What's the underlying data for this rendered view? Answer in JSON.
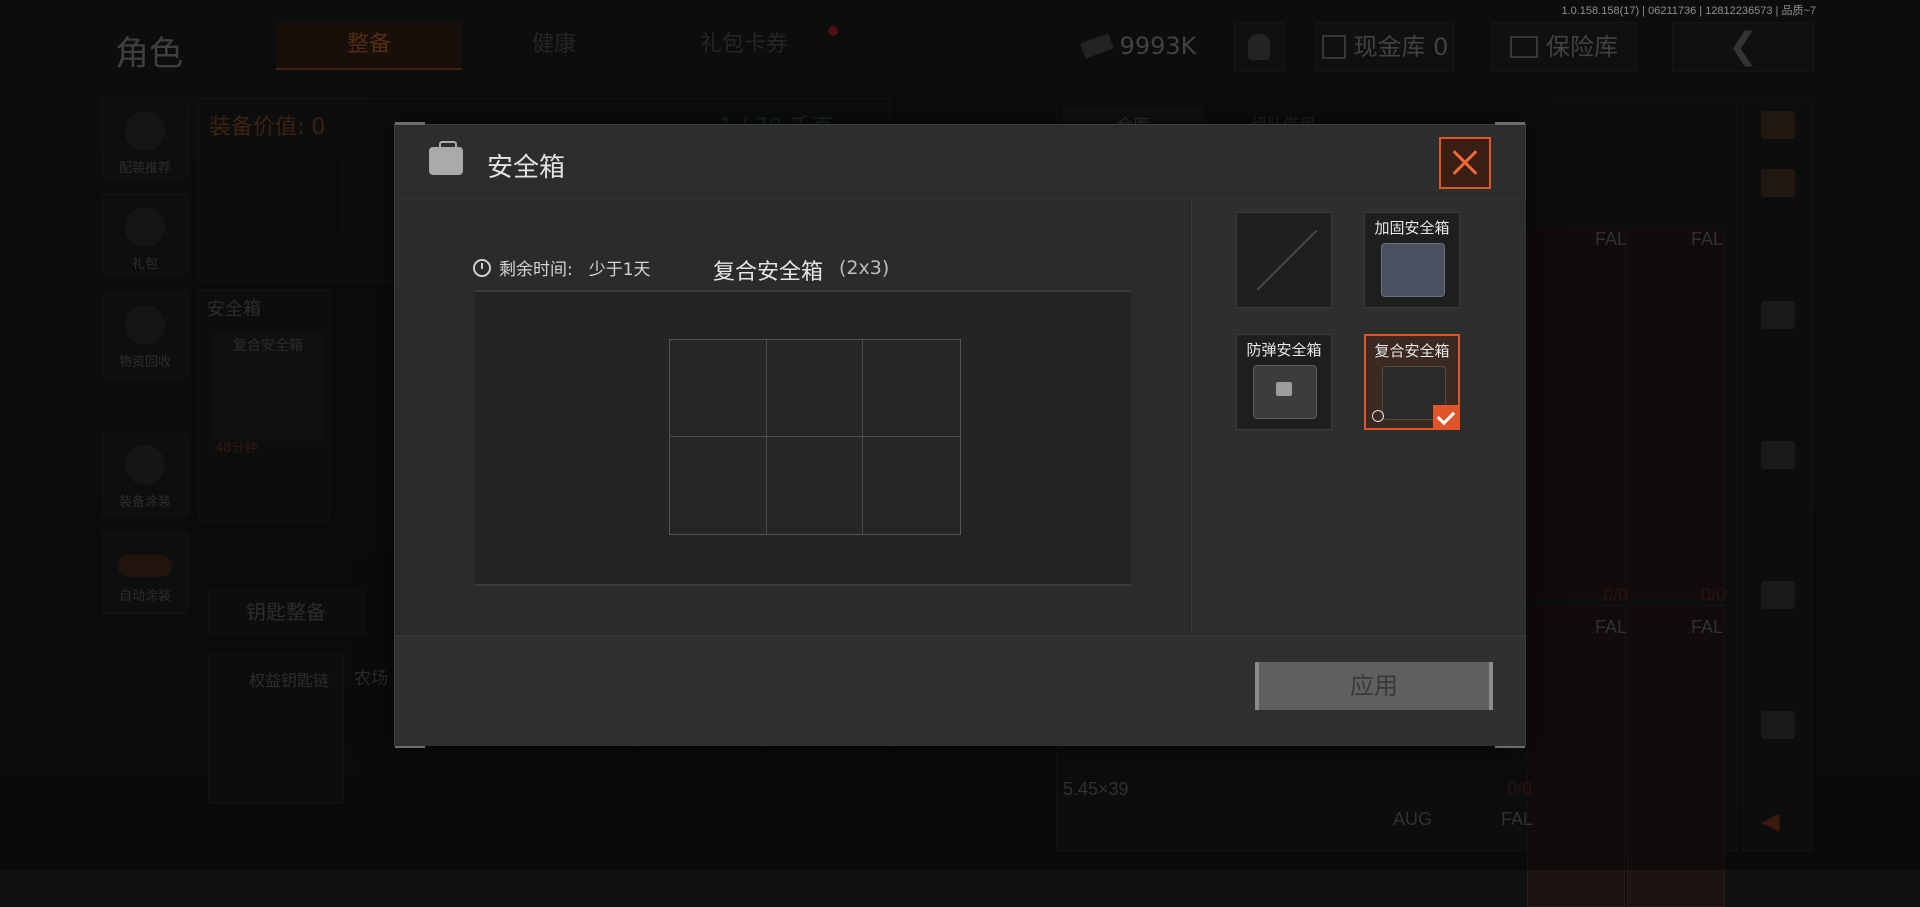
{
  "version_info": "1.0.158.158(17) | 06211736 | 12812236573 | 品质~7",
  "background": {
    "page_title": "角色",
    "tabs": [
      {
        "label": "整备",
        "active": true
      },
      {
        "label": "健康",
        "active": false
      },
      {
        "label": "礼包卡券",
        "active": false
      }
    ],
    "currency": "9993K",
    "cash_label": "现金库 0",
    "insurance_label": "保险库",
    "left_menu": [
      {
        "label": "配装推荐",
        "icon": "helmet-icon"
      },
      {
        "label": "礼包",
        "icon": "gift-icon"
      },
      {
        "label": "物资回收",
        "icon": "recycle-icon"
      },
      {
        "label": "装备涂装",
        "icon": "paint-icon"
      },
      {
        "label": "自动涂装",
        "icon": "toggle-icon"
      }
    ],
    "equip_value": "装备价值: 0",
    "capacity": "1 / 70 千克",
    "safe_box_section": "安全箱",
    "current_case": "复合安全箱",
    "current_case_timer": "48分钟",
    "key_button": "钥匙整备",
    "keychain": "权益钥匙链",
    "farm_label": "农场",
    "storage_tabs": [
      "仓库",
      "组队借用"
    ],
    "fal_labels": [
      "FAL",
      "FAL",
      "FAL",
      "FAL"
    ],
    "ratio_labels": [
      "0/0",
      "0/0",
      "0/0"
    ],
    "ammo_label": "5.45×39",
    "aug_label": "AUG",
    "partial_number": "4"
  },
  "modal": {
    "title": "安全箱",
    "icon": "case-icon",
    "timer_label": "剩余时间:",
    "timer_value": "少于1天",
    "case_name": "复合安全箱",
    "case_size": "(2x3)",
    "grid": {
      "cols": 3,
      "rows": 2
    },
    "options": [
      {
        "label": "",
        "state": "empty"
      },
      {
        "label": "加固安全箱",
        "state": "available"
      },
      {
        "label": "防弹安全箱",
        "state": "locked"
      },
      {
        "label": "复合安全箱",
        "state": "selected"
      }
    ],
    "apply_label": "应用"
  },
  "colors": {
    "accent": "#e0562a",
    "modal_bg": "#262727",
    "apply_disabled": "#5e5f5f"
  }
}
